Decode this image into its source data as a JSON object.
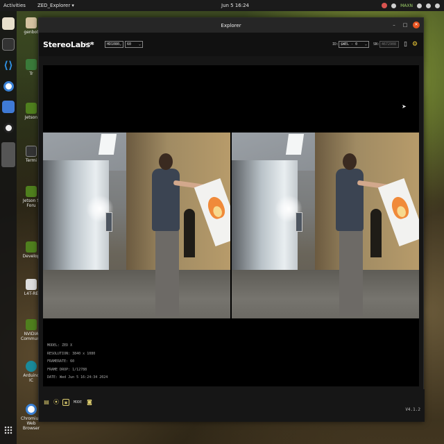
{
  "topbar": {
    "activities": "Activities",
    "app_menu": "ZED_Explorer ▾",
    "clock": "Jun 5 16:24",
    "maxn": "MAXN"
  },
  "desktop_icons": [
    {
      "label": "genbot"
    },
    {
      "label": "Tr"
    },
    {
      "label": "Jetson"
    },
    {
      "label": "Termi"
    },
    {
      "label": "Jetson S Foru"
    },
    {
      "label": "Develop"
    },
    {
      "label": "L4T-RE"
    },
    {
      "label": "NVIDIA Communit"
    },
    {
      "label": "Arduino IC"
    },
    {
      "label": "Chromium Web Browser"
    }
  ],
  "window": {
    "title": "Explorer",
    "brand": "StereoLabs*",
    "mode": "LIVE",
    "resolution_value": "HD1080",
    "fps_value": "60",
    "id_label": "ID:",
    "id_value": "$WEL - 0",
    "sn_label": "SN:",
    "sn_value": "4672908",
    "version": "V4.1.2"
  },
  "overlay": {
    "model": "MODEL: ZED X",
    "resolution": "RESOLUTION: 3840 x 1080",
    "framerate": "FRAMERATE: 60",
    "frame_drop": "FRAME DROP: 1/12788",
    "date": "DATE: Wed Jun 5 16:24:34 2024"
  },
  "bottombar": {
    "mode_label": "MODE"
  }
}
